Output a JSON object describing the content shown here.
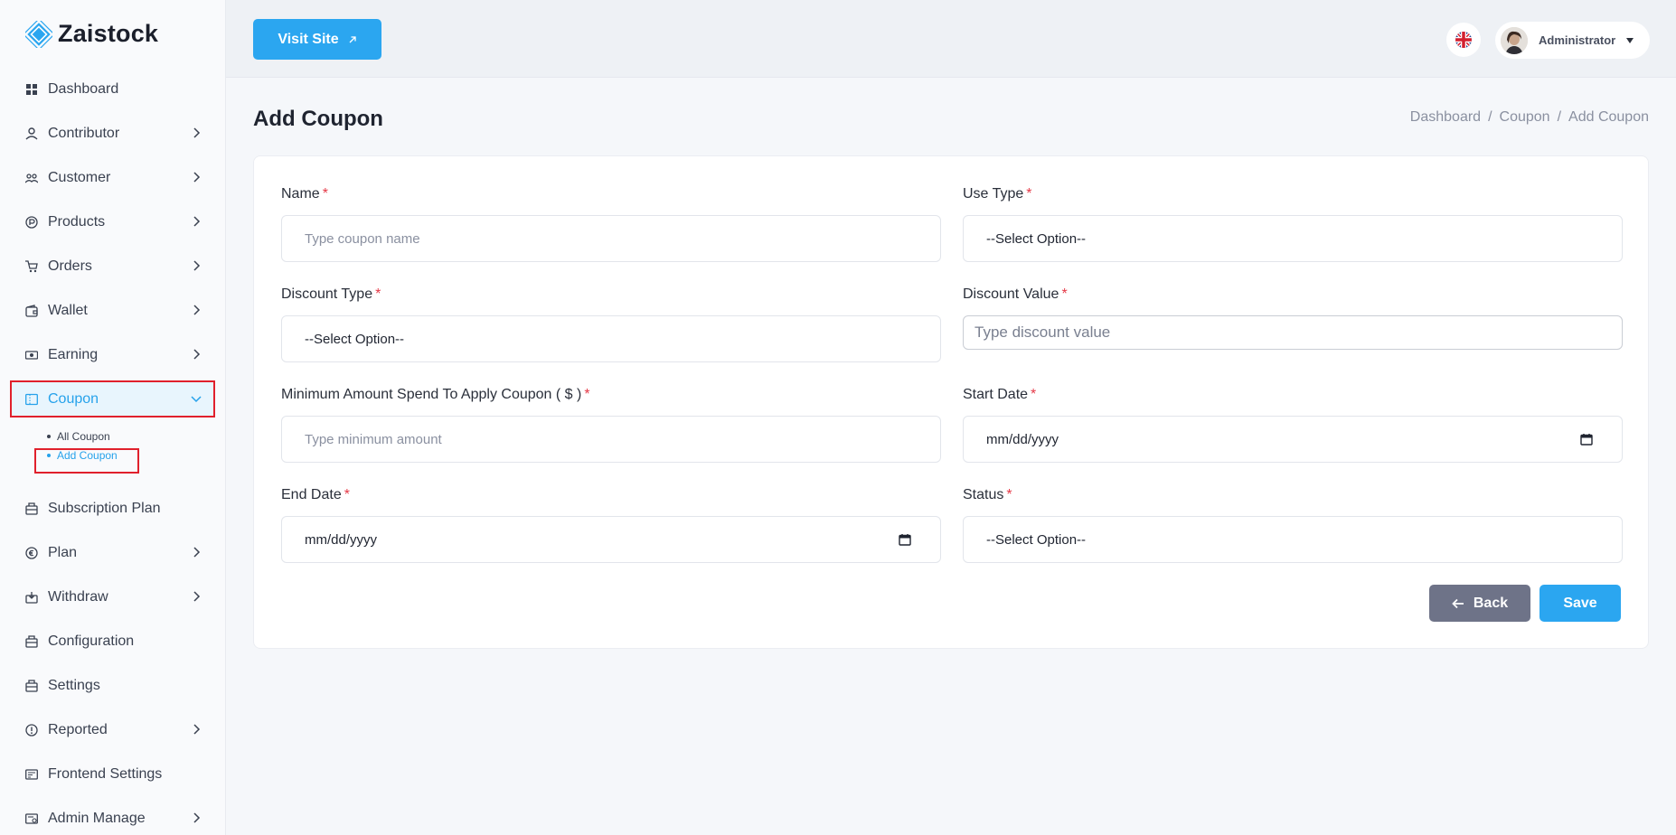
{
  "brand": {
    "name": "Zaistock"
  },
  "sidebar": {
    "items": [
      {
        "label": "Dashboard",
        "icon": "dashboard-icon",
        "has_chevron": false
      },
      {
        "label": "Contributor",
        "icon": "contributor-icon",
        "has_chevron": true
      },
      {
        "label": "Customer",
        "icon": "customer-icon",
        "has_chevron": true
      },
      {
        "label": "Products",
        "icon": "products-icon",
        "has_chevron": true
      },
      {
        "label": "Orders",
        "icon": "cart-icon",
        "has_chevron": true
      },
      {
        "label": "Wallet",
        "icon": "wallet-icon",
        "has_chevron": true
      },
      {
        "label": "Earning",
        "icon": "earning-icon",
        "has_chevron": true
      },
      {
        "label": "Coupon",
        "icon": "coupon-icon",
        "has_chevron": true,
        "active": true
      },
      {
        "label": "Subscription Plan",
        "icon": "subscription-icon",
        "has_chevron": false
      },
      {
        "label": "Plan",
        "icon": "plan-icon",
        "has_chevron": true
      },
      {
        "label": "Withdraw",
        "icon": "withdraw-icon",
        "has_chevron": true
      },
      {
        "label": "Configuration",
        "icon": "configuration-icon",
        "has_chevron": false
      },
      {
        "label": "Settings",
        "icon": "settings-icon",
        "has_chevron": false
      },
      {
        "label": "Reported",
        "icon": "reported-icon",
        "has_chevron": true
      },
      {
        "label": "Frontend Settings",
        "icon": "frontend-icon",
        "has_chevron": false
      },
      {
        "label": "Admin Manage",
        "icon": "admin-icon",
        "has_chevron": true
      }
    ],
    "coupon_sub": [
      {
        "label": "All Coupon"
      },
      {
        "label": "Add Coupon",
        "active": true
      }
    ]
  },
  "header": {
    "visit_site": "Visit Site",
    "user_name": "Administrator",
    "language_icon": "uk-flag-icon"
  },
  "page": {
    "title": "Add Coupon",
    "breadcrumb": [
      "Dashboard",
      "Coupon",
      "Add Coupon"
    ]
  },
  "form": {
    "name": {
      "label": "Name",
      "placeholder": "Type coupon name"
    },
    "use_type": {
      "label": "Use Type",
      "value": "--Select Option--"
    },
    "discount_type": {
      "label": "Discount Type",
      "value": "--Select Option--"
    },
    "discount_value": {
      "label": "Discount Value",
      "placeholder": "Type discount value"
    },
    "min_amount": {
      "label": "Minimum Amount Spend To Apply Coupon ( $ )",
      "placeholder": "Type minimum amount"
    },
    "start_date": {
      "label": "Start Date",
      "value": "mm/dd/yyyy"
    },
    "end_date": {
      "label": "End Date",
      "value": "mm/dd/yyyy"
    },
    "status": {
      "label": "Status",
      "value": "--Select Option--"
    },
    "required_mark": "*"
  },
  "actions": {
    "back": "Back",
    "save": "Save"
  },
  "colors": {
    "accent": "#2ba6f0",
    "back_button": "#6e7388",
    "highlight_border": "#e0202c",
    "required": "#e53947"
  }
}
